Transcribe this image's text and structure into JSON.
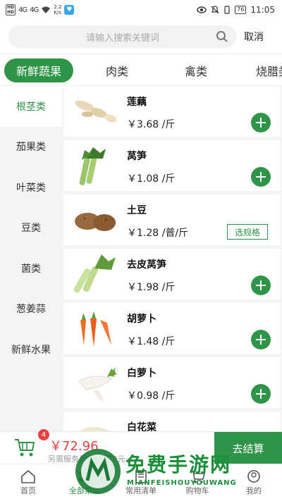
{
  "status_bar": {
    "network_speed": "2.2",
    "speed_unit": "K/s",
    "signal_1": "4G",
    "signal_2": "4G",
    "battery": "76",
    "time": "11:05"
  },
  "search": {
    "placeholder": "请输入搜索关键词",
    "cancel_label": "取消"
  },
  "category_tabs": [
    {
      "label": "新鲜蔬果",
      "active": true
    },
    {
      "label": "肉类",
      "active": false
    },
    {
      "label": "禽类",
      "active": false
    },
    {
      "label": "烧腊类",
      "active": false
    }
  ],
  "sidebar": {
    "items": [
      {
        "label": "根茎类",
        "active": true
      },
      {
        "label": "茄果类",
        "active": false
      },
      {
        "label": "叶菜类",
        "active": false
      },
      {
        "label": "豆类",
        "active": false
      },
      {
        "label": "菌类",
        "active": false
      },
      {
        "label": "葱姜蒜",
        "active": false
      },
      {
        "label": "新鲜水果",
        "active": false
      }
    ]
  },
  "products": [
    {
      "name": "莲藕",
      "price": "￥3.68 /斤",
      "action": "add",
      "image": "lotus-root-image"
    },
    {
      "name": "莴笋",
      "price": "￥1.08 /斤",
      "action": "add",
      "image": "lettuce-stem-image"
    },
    {
      "name": "土豆",
      "price": "￥1.28 /普/斤",
      "action": "spec",
      "spec_label": "选规格",
      "image": "potato-image"
    },
    {
      "name": "去皮莴笋",
      "price": "￥1.98 /斤",
      "action": "add",
      "image": "peeled-lettuce-stem-image"
    },
    {
      "name": "胡萝卜",
      "price": "￥1.48 /斤",
      "action": "add",
      "image": "carrot-image"
    },
    {
      "name": "白萝卜",
      "price": "￥0.98 /斤",
      "action": "add",
      "image": "white-radish-image"
    },
    {
      "name": "白花菜",
      "price": "",
      "action": "none",
      "image": "cauliflower-image"
    }
  ],
  "cart": {
    "count": "4",
    "total": "￥72.96",
    "note": "另需服务费 配送费0元",
    "checkout_label": "去结算"
  },
  "bottom_nav": [
    {
      "label": "首页",
      "active": false,
      "icon": "home-icon"
    },
    {
      "label": "全部菜品",
      "active": true,
      "icon": "category-icon"
    },
    {
      "label": "常用清单",
      "active": false,
      "icon": "list-icon"
    },
    {
      "label": "购物车",
      "active": false,
      "icon": "cart-icon"
    },
    {
      "label": "我的",
      "active": false,
      "icon": "profile-icon"
    }
  ],
  "watermark": {
    "title": "免费手游网",
    "subtitle": "MIANFEISHOUYOUWANG"
  },
  "colors": {
    "accent": "#2e9447",
    "price_red": "#e64040"
  }
}
